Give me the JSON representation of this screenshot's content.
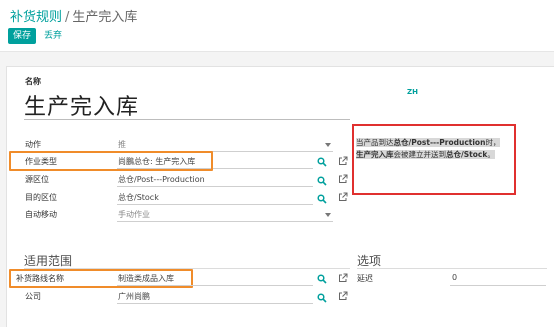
{
  "breadcrumb": {
    "parent": "补货规则",
    "separator": "/",
    "current": "生产完入库"
  },
  "buttons": {
    "save": "保存",
    "discard": "丢弃"
  },
  "form": {
    "name_label": "名称",
    "name_value": "生产完入库",
    "lang_badge": "ZH",
    "fields": {
      "action": {
        "label": "动作",
        "value": "推"
      },
      "operation_type": {
        "label": "作业类型",
        "value": "尚鵬总仓: 生产完入库"
      },
      "source_location": {
        "label": "源区位",
        "value": "总仓/Post---Production"
      },
      "dest_location": {
        "label": "目的区位",
        "value": "总仓/Stock"
      },
      "auto_move": {
        "label": "自动移动",
        "value": "手动作业"
      }
    }
  },
  "tip": {
    "part1": "当产品到达",
    "part2": "总仓/Post---Production",
    "part3": "时，",
    "part4": "生产完入库",
    "part5": "会被建立并送到",
    "part6": "总仓/Stock",
    "part7": "。"
  },
  "scope": {
    "title": "适用范围",
    "route": {
      "label": "补货路线名称",
      "value": "制造类成品入库"
    },
    "company": {
      "label": "公司",
      "value": "广州尚鹏"
    }
  },
  "options": {
    "title": "选项",
    "delay": {
      "label": "延迟",
      "value": "0"
    }
  },
  "colors": {
    "accent": "#00a09d",
    "highlight_box": "#f08c2a",
    "tip_box": "#e0302f"
  },
  "icons": [
    "search-icon",
    "external-link-icon",
    "chevron-down-icon"
  ]
}
